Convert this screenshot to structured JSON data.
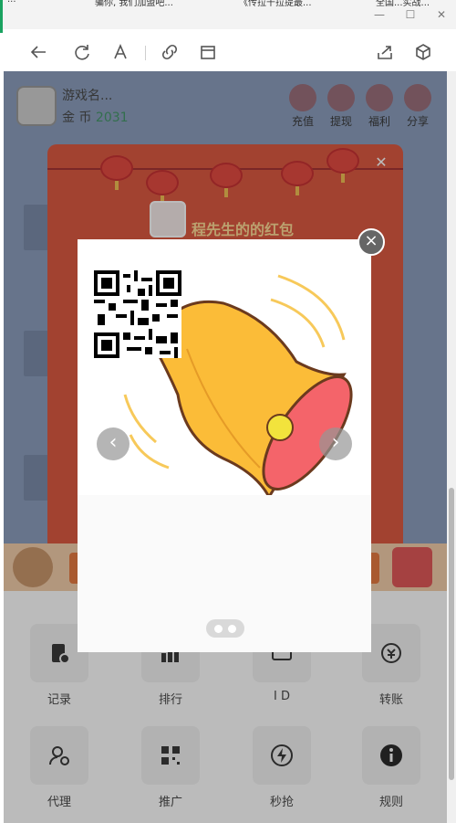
{
  "browser": {
    "tabs": [
      "...",
      "骗你, 我们加盟吧...",
      "《传拉干拉提最...",
      "全国...实战..."
    ],
    "window_controls": {
      "minimize": "—",
      "maximize": "☐",
      "close": "✕"
    },
    "toolbar_icons": [
      "back-icon",
      "refresh-icon",
      "font-icon",
      "link-icon",
      "tab-icon",
      "share-icon",
      "cube-icon"
    ],
    "accent_color": "#1aa260"
  },
  "game": {
    "name": "游戏名...",
    "coin_label": "金 币",
    "coin_amount": "2031",
    "actions": [
      {
        "label": "充值",
        "icon": "recharge-icon"
      },
      {
        "label": "提现",
        "icon": "withdraw-icon"
      },
      {
        "label": "福利",
        "icon": "gift-icon"
      },
      {
        "label": "分享",
        "icon": "share-icon"
      }
    ]
  },
  "envelope": {
    "title": "程先生的的红包",
    "close": "✕"
  },
  "grid": [
    {
      "label": "记录",
      "icon": "record-icon"
    },
    {
      "label": "排行",
      "icon": "rank-icon"
    },
    {
      "label": "I D",
      "icon": "id-icon"
    },
    {
      "label": "转账",
      "icon": "transfer-icon"
    },
    {
      "label": "代理",
      "icon": "agent-icon"
    },
    {
      "label": "推广",
      "icon": "qrcode-icon"
    },
    {
      "label": "秒抢",
      "icon": "lightning-icon"
    },
    {
      "label": "规则",
      "icon": "info-icon"
    }
  ],
  "modal": {
    "close": "×",
    "prev": "‹",
    "next": "›",
    "slides": 2,
    "active_slide": 1
  },
  "colors": {
    "page_bg": "#7e93b6",
    "envelope_red": "#d9452a",
    "bell_yellow": "#fbbc38",
    "bell_pink": "#f4646a"
  }
}
